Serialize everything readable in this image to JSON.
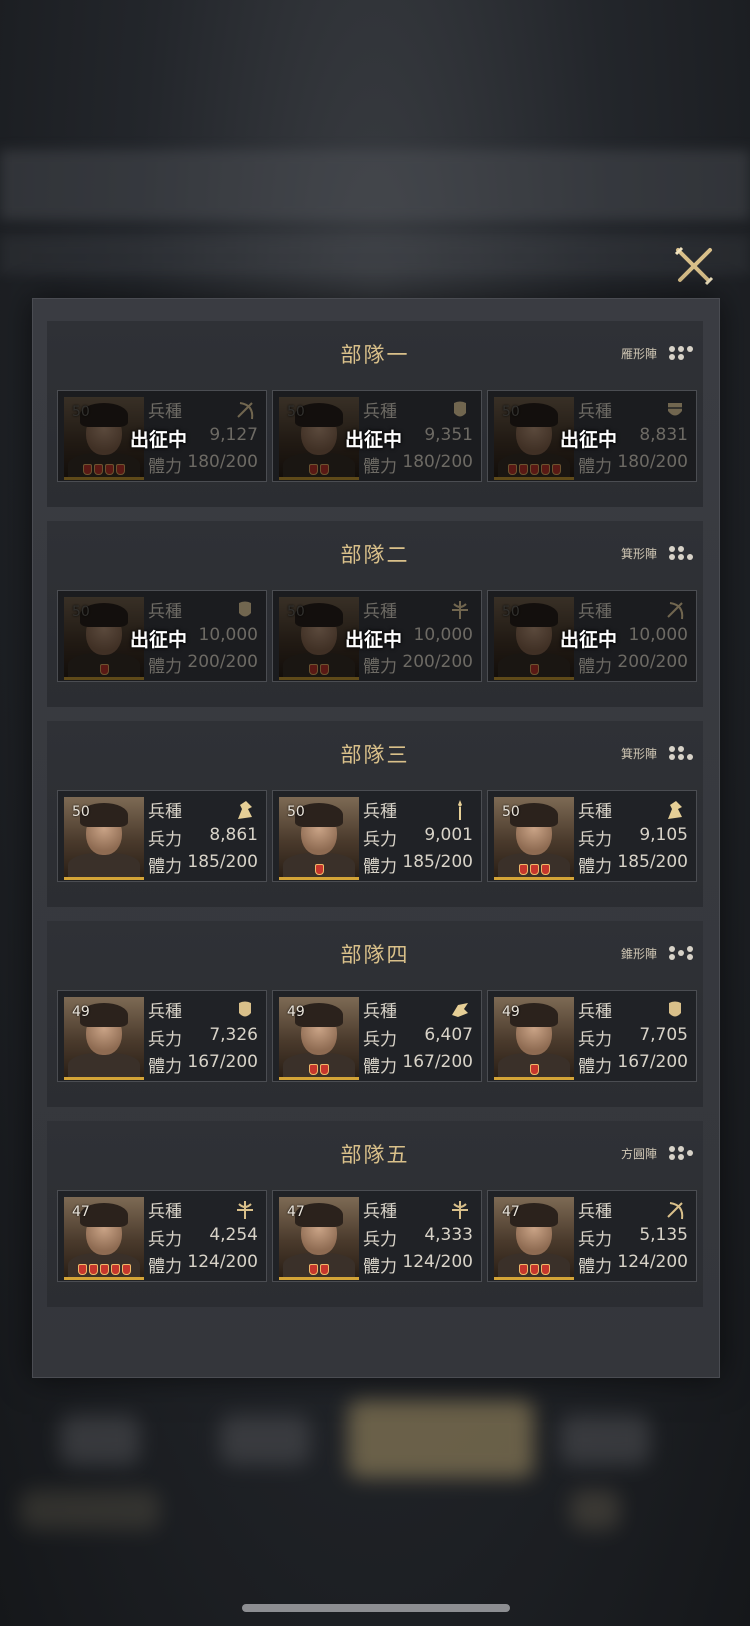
{
  "close_icon": "crossed-swords-close-icon",
  "squads": [
    {
      "title": "部隊一",
      "formation": "雁形陣",
      "dots": "pattern-a",
      "cards": [
        {
          "level": "50",
          "type_label": "兵種",
          "troop_icon": "bow-icon",
          "status": "出征中",
          "force_value": "9,127",
          "stamina_label": "體力",
          "stamina": "180/200",
          "stars": 4,
          "dim": true
        },
        {
          "level": "50",
          "type_label": "兵種",
          "troop_icon": "shield-icon",
          "status": "出征中",
          "force_value": "9,351",
          "stamina_label": "體力",
          "stamina": "180/200",
          "stars": 2,
          "dim": true
        },
        {
          "level": "50",
          "type_label": "兵種",
          "troop_icon": "heavy-shield-icon",
          "status": "出征中",
          "force_value": "8,831",
          "stamina_label": "體力",
          "stamina": "180/200",
          "stars": 5,
          "dim": true
        }
      ]
    },
    {
      "title": "部隊二",
      "formation": "箕形陣",
      "dots": "pattern-b",
      "cards": [
        {
          "level": "50",
          "type_label": "兵種",
          "troop_icon": "shield-icon",
          "status": "出征中",
          "force_value": "10,000",
          "stamina_label": "體力",
          "stamina": "200/200",
          "stars": 1,
          "dim": true
        },
        {
          "level": "50",
          "type_label": "兵種",
          "troop_icon": "crossbow-icon",
          "status": "出征中",
          "force_value": "10,000",
          "stamina_label": "體力",
          "stamina": "200/200",
          "stars": 2,
          "dim": true
        },
        {
          "level": "50",
          "type_label": "兵種",
          "troop_icon": "bow-icon",
          "status": "出征中",
          "force_value": "10,000",
          "stamina_label": "體力",
          "stamina": "200/200",
          "stars": 1,
          "dim": true
        }
      ]
    },
    {
      "title": "部隊三",
      "formation": "箕形陣",
      "dots": "pattern-b",
      "cards": [
        {
          "level": "50",
          "type_label": "兵種",
          "troop_icon": "cavalry-icon",
          "force_label": "兵力",
          "force_value": "8,861",
          "stamina_label": "體力",
          "stamina": "185/200",
          "stars": 0,
          "dim": false
        },
        {
          "level": "50",
          "type_label": "兵種",
          "troop_icon": "spear-icon",
          "force_label": "兵力",
          "force_value": "9,001",
          "stamina_label": "體力",
          "stamina": "185/200",
          "stars": 1,
          "dim": false
        },
        {
          "level": "50",
          "type_label": "兵種",
          "troop_icon": "cavalry-icon",
          "force_label": "兵力",
          "force_value": "9,105",
          "stamina_label": "體力",
          "stamina": "185/200",
          "stars": 3,
          "dim": false
        }
      ]
    },
    {
      "title": "部隊四",
      "formation": "錐形陣",
      "dots": "pattern-c",
      "cards": [
        {
          "level": "49",
          "type_label": "兵種",
          "troop_icon": "shield-icon",
          "force_label": "兵力",
          "force_value": "7,326",
          "stamina_label": "體力",
          "stamina": "167/200",
          "stars": 0,
          "dim": false
        },
        {
          "level": "49",
          "type_label": "兵種",
          "troop_icon": "charge-icon",
          "force_label": "兵力",
          "force_value": "6,407",
          "stamina_label": "體力",
          "stamina": "167/200",
          "stars": 2,
          "dim": false
        },
        {
          "level": "49",
          "type_label": "兵種",
          "troop_icon": "shield-icon",
          "force_label": "兵力",
          "force_value": "7,705",
          "stamina_label": "體力",
          "stamina": "167/200",
          "stars": 1,
          "dim": false
        }
      ]
    },
    {
      "title": "部隊五",
      "formation": "方圓陣",
      "dots": "pattern-d",
      "cards": [
        {
          "level": "47",
          "type_label": "兵種",
          "troop_icon": "crossbow-icon",
          "force_label": "兵力",
          "force_value": "4,254",
          "stamina_label": "體力",
          "stamina": "124/200",
          "stars": 5,
          "dim": false
        },
        {
          "level": "47",
          "type_label": "兵種",
          "troop_icon": "crossbow-icon",
          "force_label": "兵力",
          "force_value": "4,333",
          "stamina_label": "體力",
          "stamina": "124/200",
          "stars": 2,
          "dim": false
        },
        {
          "level": "47",
          "type_label": "兵種",
          "troop_icon": "bow-icon",
          "force_label": "兵力",
          "force_value": "5,135",
          "stamina_label": "體力",
          "stamina": "124/200",
          "stars": 3,
          "dim": false
        }
      ]
    }
  ]
}
